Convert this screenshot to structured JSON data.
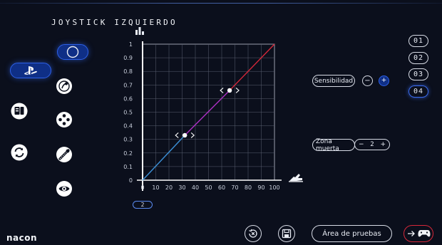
{
  "header": {
    "title": "JOYSTICK IZQUIERDO"
  },
  "nav": {
    "items": [
      {
        "name": "playstation-mode",
        "icon": "playstation-icon",
        "active": true
      },
      {
        "name": "pc-mode",
        "icon": "pc-tower-icon",
        "active": false
      },
      {
        "name": "refresh",
        "icon": "refresh-icon",
        "active": false
      }
    ]
  },
  "modes": [
    {
      "icon": "circle-icon",
      "active": true
    },
    {
      "icon": "stick-icon",
      "active": false
    },
    {
      "icon": "dpad-icon",
      "active": false
    },
    {
      "icon": "stick-tilt-icon",
      "active": false
    },
    {
      "icon": "eye-icon",
      "active": false
    }
  ],
  "chart_data": {
    "type": "line",
    "x_ticks": [
      "0",
      "10",
      "20",
      "30",
      "40",
      "50",
      "60",
      "70",
      "80",
      "90",
      "100"
    ],
    "y_ticks": [
      "0",
      "0.1",
      "0.2",
      "0.3",
      "0.4",
      "0.5",
      "0.6",
      "0.7",
      "0.8",
      "0.9",
      "1"
    ],
    "xlim": [
      0,
      100
    ],
    "ylim": [
      0,
      1
    ],
    "grid": true,
    "series": [
      {
        "color": "#3b8fd6",
        "x": [
          0,
          32
        ],
        "y": [
          0,
          0.33
        ]
      },
      {
        "color": "#b030c8",
        "x": [
          32,
          66
        ],
        "y": [
          0.33,
          0.66
        ]
      },
      {
        "color": "#d8283a",
        "x": [
          66,
          100
        ],
        "y": [
          0.66,
          1
        ]
      }
    ],
    "control_points": [
      {
        "x": 32,
        "y": 0.33
      },
      {
        "x": 66,
        "y": 0.66
      }
    ],
    "x_value_tag": "2"
  },
  "profiles": [
    {
      "label": "01",
      "active": false
    },
    {
      "label": "02",
      "active": false
    },
    {
      "label": "03",
      "active": false
    },
    {
      "label": "04",
      "active": true
    }
  ],
  "sensitivity": {
    "label": "Sensibilidad",
    "minus": "−",
    "plus": "+"
  },
  "deadzone": {
    "label": "Zona muerta",
    "minus": "−",
    "value": "2",
    "plus": "+"
  },
  "footer": {
    "logo": "nacon",
    "test_area_label": "Área de pruebas"
  },
  "colors": {
    "accent_blue": "#2d60e6",
    "curve_low": "#3b8fd6",
    "curve_mid": "#b030c8",
    "curve_high": "#d8283a",
    "background": "#0b0f1c"
  }
}
